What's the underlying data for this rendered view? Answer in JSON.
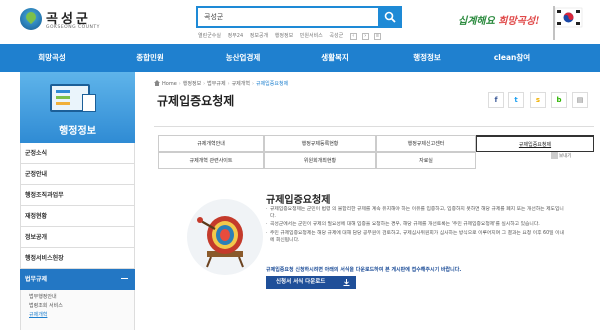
{
  "header": {
    "logo_name": "곡성군",
    "logo_en": "GOKSEONG COUNTY",
    "search_value": "곡성군",
    "quick_links": [
      "열린군수실",
      "정부24",
      "정보공개",
      "행정정보",
      "민원서비스",
      "곡성군"
    ],
    "slogan_a": "십계해요",
    "slogan_b": "희망곡성!"
  },
  "gnb": [
    "희망곡성",
    "종합민원",
    "농산업경제",
    "생활복지",
    "행정정보",
    "clean참여"
  ],
  "sidebar": {
    "title": "행정정보",
    "items": [
      {
        "label": "군정소식"
      },
      {
        "label": "군정안내"
      },
      {
        "label": "행정조직과업무"
      },
      {
        "label": "재정현황"
      },
      {
        "label": "정보공개"
      },
      {
        "label": "행정서비스헌장"
      },
      {
        "label": "법무규제",
        "active": true
      }
    ],
    "subitems": [
      {
        "label": "법무행정안내"
      },
      {
        "label": "법령조회 서비스"
      },
      {
        "label": "규제개혁",
        "current": true
      }
    ]
  },
  "breadcrumb": [
    "Home",
    "행정정보",
    "법무규제",
    "규제개혁",
    "규제입증요청제"
  ],
  "page_title": "규제입증요청제",
  "share_icons": [
    "facebook-icon",
    "twitter-icon",
    "kakaostory-icon",
    "blog-icon",
    "print-icon"
  ],
  "tabs": [
    {
      "label": "규제개혁안내"
    },
    {
      "label": "행정규제등록현황"
    },
    {
      "label": "행정규제신고센터"
    },
    {
      "label": "규제입증요청제",
      "active": true
    },
    {
      "label": "규제개혁 관련사이트"
    },
    {
      "label": "위원회개최현황"
    },
    {
      "label": "자료실"
    }
  ],
  "qr_label": "보내기",
  "content": {
    "title": "규제입증요청제",
    "paragraphs": [
      "규제입증요청제는 군민이 법령 의 불합리한 규제를 계속 유지해야 하는 이유를 입증하고, 입증하지 못하면 해당 규제를 폐지 또는 개선하는 제도입니다.",
      "곡성군에서는 군민이 규제의 필요성에 대해 입증을 요청하는 경우, 해당 규제를 개선토록는 '주민 규제입증요청제'를 실시하고 있습니다.",
      "주민 규제입증요청제는 해당 규제에 대해 담당 공무원이 검토하고, 규제심사위원회가 심사하는 방식으로 이루어지며 그 결과는 요청 이후 60일 이내에 회신됩니다."
    ],
    "note": "규제입증요청 신청하시려면 아래의 서식을 다운로드하여 본 게시판에 접수해주시기 바랍니다.",
    "download_label": "신청서 서식 다운로드"
  }
}
